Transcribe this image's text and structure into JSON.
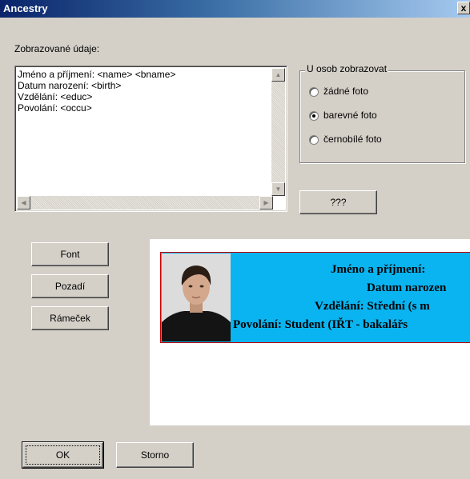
{
  "window": {
    "title": "Ancestry",
    "close_glyph": "x"
  },
  "displayed_data_label": "Zobrazované údaje:",
  "template_lines": [
    "Jméno a příjmení: <name> <bname>",
    "Datum narození: <birth>",
    "Vzdělání: <educ>",
    "Povolání: <occu>"
  ],
  "photo_group": {
    "title": "U osob zobrazovat",
    "options": [
      {
        "label": "žádné foto",
        "checked": false
      },
      {
        "label": "barevné foto",
        "checked": true
      },
      {
        "label": "černobílé foto",
        "checked": false
      }
    ]
  },
  "buttons": {
    "help": "???",
    "font": "Font",
    "background": "Pozadí",
    "frame": "Rámeček",
    "ok": "OK",
    "cancel": "Storno"
  },
  "preview": {
    "lines": [
      "Jméno a příjmení: ",
      "Datum narozen",
      "Vzdělání: Střední (s m",
      "Povolání: Student (IŘT - bakalářs"
    ],
    "card_color": "#0ab4f0",
    "border_color": "#c00000"
  }
}
